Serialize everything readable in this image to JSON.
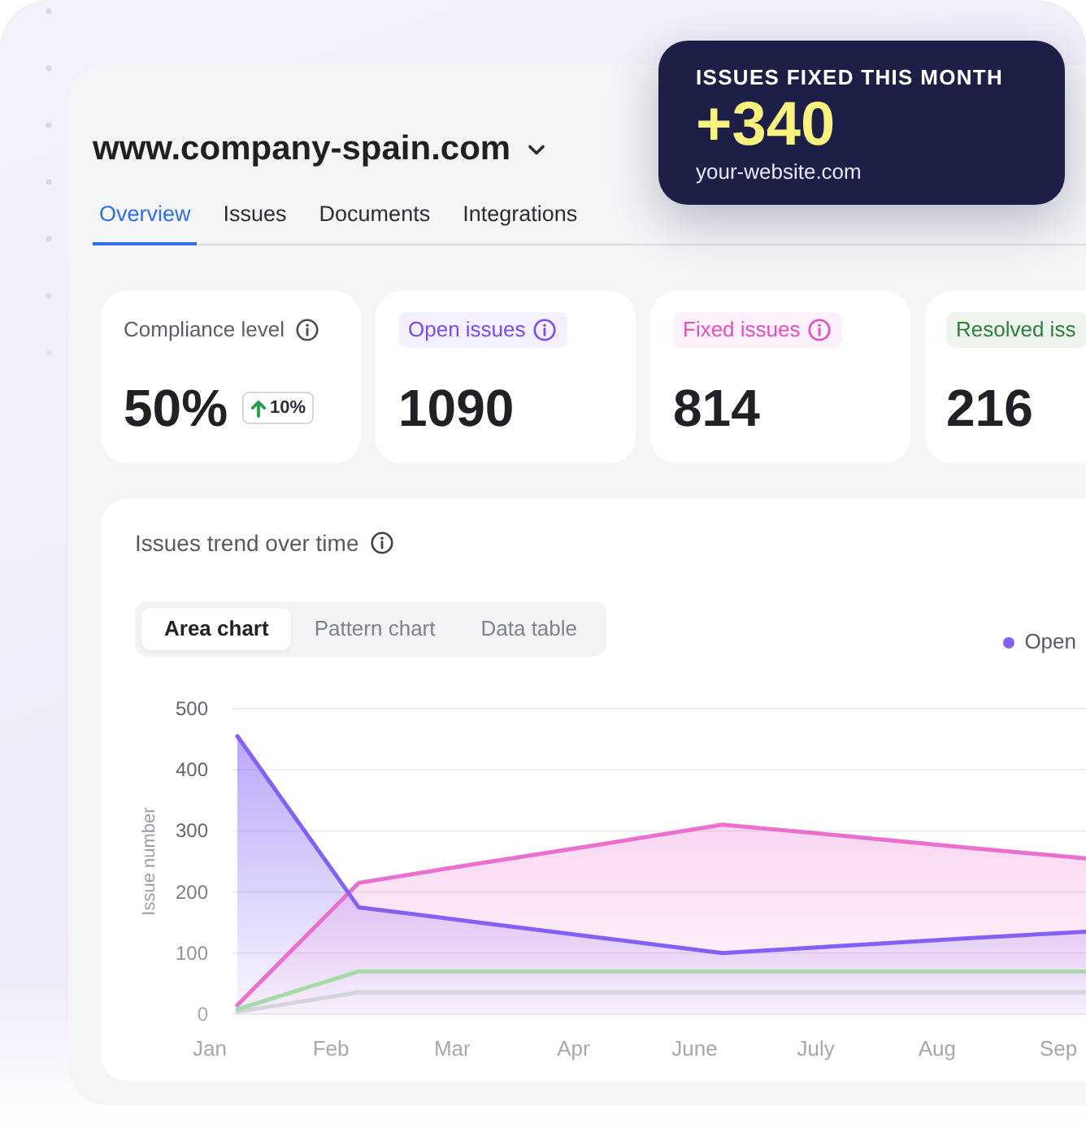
{
  "highlight": {
    "title": "ISSUES FIXED THIS MONTH",
    "value": "+340",
    "site": "your-website.com"
  },
  "site": {
    "title": "www.company-spain.com"
  },
  "tabs": [
    {
      "label": "Overview",
      "selected": true
    },
    {
      "label": "Issues",
      "selected": false
    },
    {
      "label": "Documents",
      "selected": false
    },
    {
      "label": "Integrations",
      "selected": false
    }
  ],
  "stats": [
    {
      "kind": "plain",
      "label": "Compliance level",
      "value": "50%",
      "change": "10%"
    },
    {
      "kind": "tag",
      "label": "Open issues",
      "value": "1090",
      "color": "#7a4cf7"
    },
    {
      "kind": "tag",
      "label": "Fixed issues",
      "value": "814",
      "color": "#e24fc5"
    },
    {
      "kind": "tag",
      "label": "Resolved iss",
      "value": "216",
      "color": "#2f7d3a"
    }
  ],
  "chart": {
    "title": "Issues trend over time",
    "views": [
      {
        "label": "Area chart",
        "selected": true
      },
      {
        "label": "Pattern chart",
        "selected": false
      },
      {
        "label": "Data table",
        "selected": false
      }
    ],
    "chart_data": {
      "type": "area",
      "ylabel": "Issue number",
      "grid": true,
      "categories": [
        "Jan",
        "Feb",
        "Mar",
        "Apr",
        "June",
        "July",
        "Aug",
        "Sep"
      ],
      "ylim": [
        0,
        500
      ],
      "yticks": [
        0,
        100,
        200,
        300,
        400,
        500
      ],
      "series": [
        {
          "name": "Open",
          "color": "#8360f6",
          "values": [
            455,
            175,
            150,
            125,
            100,
            112,
            124,
            135
          ]
        },
        {
          "color": "#ea6fcf",
          "values": [
            15,
            215,
            247,
            278,
            310,
            292,
            273,
            255
          ]
        },
        {
          "type": "line",
          "color": "#a6dba8",
          "values": [
            8,
            70,
            70,
            70,
            70,
            70,
            70,
            70
          ]
        },
        {
          "type": "line",
          "color": "#d4d5db",
          "values": [
            4,
            36,
            36,
            36,
            36,
            36,
            36,
            36
          ]
        }
      ]
    }
  }
}
